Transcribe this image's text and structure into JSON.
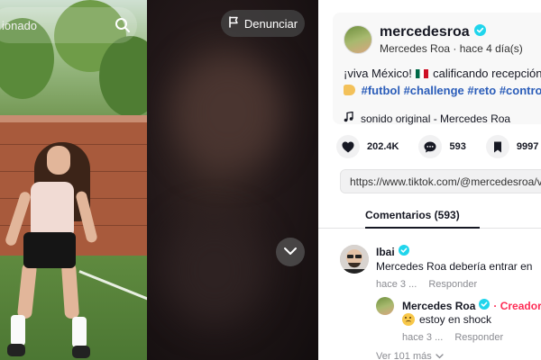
{
  "search": {
    "placeholder": "ionado"
  },
  "video": {
    "report_label": "Denunciar"
  },
  "post": {
    "username": "mercedesroa",
    "display_name": "Mercedes Roa",
    "time_ago": "hace 4 día(s)",
    "caption_text": "¡viva México!",
    "caption_text2": "calificando recepción",
    "hashtags": [
      "#futbol",
      "#challenge",
      "#reto",
      "#control"
    ],
    "music": "sonido original - Mercedes Roa",
    "likes": "202.4K",
    "comments": "593",
    "saves": "9997",
    "url": "https://www.tiktok.com/@mercedesroa/video"
  },
  "tabs": {
    "comments_label": "Comentarios (593)"
  },
  "comments": [
    {
      "author": "Ibai",
      "text": "Mercedes Roa debería entrar en",
      "time": "hace 3 ...",
      "reply_label": "Responder"
    },
    {
      "author": "Mercedes Roa",
      "badge": "Creador",
      "text": "estoy en shock",
      "time": "hace 3 ...",
      "reply_label": "Responder"
    }
  ],
  "see_more": "Ver 101 más",
  "colors": {
    "hashtag": "#2b5db9",
    "creator": "#fe2c55",
    "verified": "#20d5ec"
  }
}
